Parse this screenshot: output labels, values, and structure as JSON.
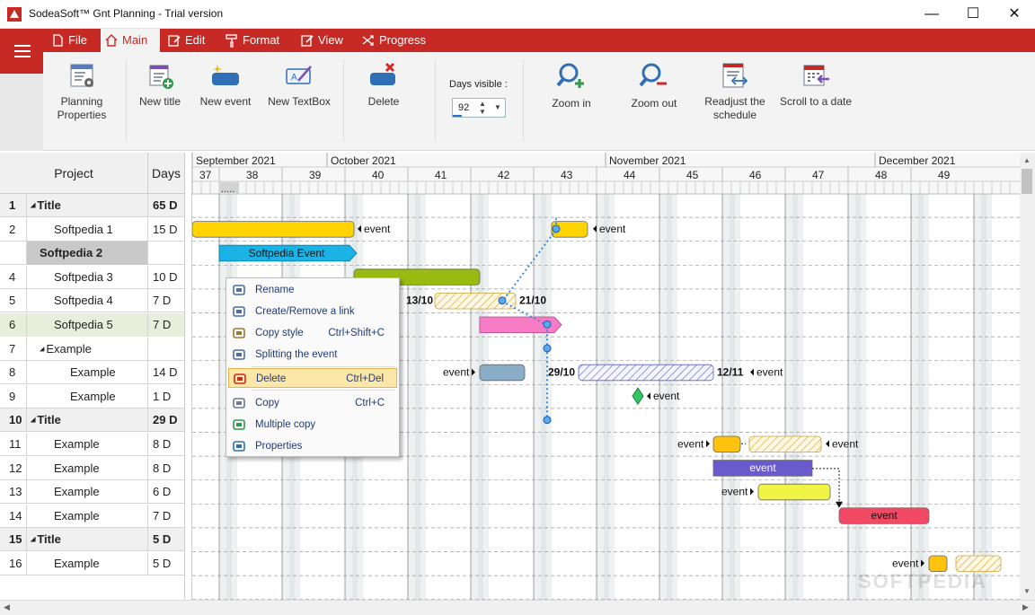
{
  "window": {
    "title": "SodeaSoft™ Gnt Planning - Trial version",
    "minimize": "—",
    "maximize": "☐",
    "close": "✕"
  },
  "menu": {
    "tabs": [
      "File",
      "Main",
      "Edit",
      "Format",
      "View",
      "Progress"
    ],
    "active": "Main"
  },
  "ribbon": {
    "planning_properties": "Planning Properties",
    "new_title": "New title",
    "new_event": "New event",
    "new_textbox": "New TextBox",
    "delete": "Delete",
    "days_visible_label": "Days visible :",
    "days_visible_value": "92",
    "zoom_in": "Zoom in",
    "zoom_out": "Zoom out",
    "readjust": "Readjust the schedule",
    "scroll_to_date": "Scroll to a date"
  },
  "table": {
    "header": {
      "project": "Project",
      "days": "Days"
    },
    "rows": [
      {
        "num": "1",
        "name": "Title",
        "days": "65 D",
        "type": "title"
      },
      {
        "num": "2",
        "name": "Softpedia 1",
        "days": "15 D",
        "type": "item"
      },
      {
        "num": "",
        "name": "Softpedia 2",
        "days": "",
        "type": "gray"
      },
      {
        "num": "4",
        "name": "Softpedia 3",
        "days": "10 D",
        "type": "item"
      },
      {
        "num": "5",
        "name": "Softpedia 4",
        "days": "7 D",
        "type": "item"
      },
      {
        "num": "6",
        "name": "Softpedia 5",
        "days": "7 D",
        "type": "green"
      },
      {
        "num": "7",
        "name": "Example",
        "days": "",
        "type": "sub"
      },
      {
        "num": "8",
        "name": "Example",
        "days": "14 D",
        "type": "subitem"
      },
      {
        "num": "9",
        "name": "Example",
        "days": "1 D",
        "type": "subitem"
      },
      {
        "num": "10",
        "name": "Title",
        "days": "29 D",
        "type": "title"
      },
      {
        "num": "11",
        "name": "Example",
        "days": "8 D",
        "type": "item"
      },
      {
        "num": "12",
        "name": "Example",
        "days": "8 D",
        "type": "item"
      },
      {
        "num": "13",
        "name": "Example",
        "days": "6 D",
        "type": "item"
      },
      {
        "num": "14",
        "name": "Example",
        "days": "7 D",
        "type": "item"
      },
      {
        "num": "15",
        "name": "Title",
        "days": "5 D",
        "type": "title"
      },
      {
        "num": "16",
        "name": "Example",
        "days": "5 D",
        "type": "item"
      }
    ]
  },
  "timeline": {
    "months": [
      "September 2021",
      "October 2021",
      "November 2021",
      "December 2021"
    ],
    "weeks": [
      "37",
      "38",
      "39",
      "40",
      "41",
      "42",
      "43",
      "44",
      "45",
      "46",
      "47",
      "48",
      "49"
    ],
    "scroll_marker": "....."
  },
  "gantt_labels": {
    "event": "event",
    "softpedia_event": "Softpedia Event",
    "date_1310": "13/10",
    "date_2110": "21/10",
    "date_2910": "29/10",
    "date_1211": "12/11"
  },
  "context_menu": [
    {
      "label": "Rename",
      "shortcut": "",
      "icon": "rename-icon"
    },
    {
      "label": "Create/Remove a link",
      "shortcut": "",
      "icon": "link-icon"
    },
    {
      "label": "Copy style",
      "shortcut": "Ctrl+Shift+C",
      "icon": "brush-icon"
    },
    {
      "label": "Splitting the event",
      "shortcut": "",
      "icon": "split-icon"
    },
    {
      "label": "Delete",
      "shortcut": "Ctrl+Del",
      "icon": "delete-icon"
    },
    {
      "label": "Copy",
      "shortcut": "Ctrl+C",
      "icon": "copy-icon"
    },
    {
      "label": "Multiple copy",
      "shortcut": "",
      "icon": "multiple-copy-icon"
    },
    {
      "label": "Properties",
      "shortcut": "",
      "icon": "properties-icon"
    }
  ],
  "watermark": "SOFTPEDIA",
  "colors": {
    "accent": "#c72a24",
    "yellow": "#ffd400",
    "cyan": "#19b3e6",
    "green": "#99bb11",
    "pink": "#f77cc5",
    "steel": "#8aaec8",
    "orange": "#ffc20e",
    "purple": "#6a5acd",
    "lime": "#f0f545",
    "red": "#f24a64"
  }
}
